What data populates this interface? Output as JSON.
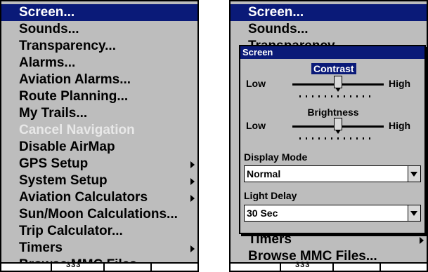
{
  "menu": {
    "items": [
      {
        "label": "Screen...",
        "selected": true,
        "disabled": false,
        "submenu": false
      },
      {
        "label": "Sounds...",
        "selected": false,
        "disabled": false,
        "submenu": false
      },
      {
        "label": "Transparency...",
        "selected": false,
        "disabled": false,
        "submenu": false
      },
      {
        "label": "Alarms...",
        "selected": false,
        "disabled": false,
        "submenu": false
      },
      {
        "label": "Aviation Alarms...",
        "selected": false,
        "disabled": false,
        "submenu": false
      },
      {
        "label": "Route Planning...",
        "selected": false,
        "disabled": false,
        "submenu": false
      },
      {
        "label": "My Trails...",
        "selected": false,
        "disabled": false,
        "submenu": false
      },
      {
        "label": "Cancel Navigation",
        "selected": false,
        "disabled": true,
        "submenu": false
      },
      {
        "label": "Disable AirMap",
        "selected": false,
        "disabled": false,
        "submenu": false
      },
      {
        "label": "GPS Setup",
        "selected": false,
        "disabled": false,
        "submenu": true
      },
      {
        "label": "System Setup",
        "selected": false,
        "disabled": false,
        "submenu": true
      },
      {
        "label": "Aviation Calculators",
        "selected": false,
        "disabled": false,
        "submenu": true
      },
      {
        "label": "Sun/Moon Calculations...",
        "selected": false,
        "disabled": false,
        "submenu": false
      },
      {
        "label": "Trip Calculator...",
        "selected": false,
        "disabled": false,
        "submenu": false
      },
      {
        "label": "Timers",
        "selected": false,
        "disabled": false,
        "submenu": true
      },
      {
        "label": "Browse MMC Files...",
        "selected": false,
        "disabled": false,
        "submenu": false
      }
    ]
  },
  "right_menu": {
    "top_items": [
      "Screen...",
      "Sounds...",
      "Transparency..."
    ],
    "bottom_items": [
      {
        "label": "Timers",
        "submenu": true
      },
      {
        "label": "Browse MMC Files...",
        "submenu": false
      }
    ]
  },
  "bottom_bar": {
    "left_text": "333"
  },
  "dialog": {
    "title": "Screen",
    "contrast": {
      "label": "Contrast",
      "low": "Low",
      "high": "High",
      "level": 0.5
    },
    "brightness": {
      "label": "Brightness",
      "low": "Low",
      "high": "High",
      "level": 0.5
    },
    "display_mode": {
      "label": "Display Mode",
      "value": "Normal"
    },
    "light_delay": {
      "label": "Light Delay",
      "value": "30 Sec"
    }
  },
  "colors": {
    "highlight": "#0a1a78",
    "panel": "#bdbdbd",
    "disabled_text": "#e8e8e8"
  }
}
